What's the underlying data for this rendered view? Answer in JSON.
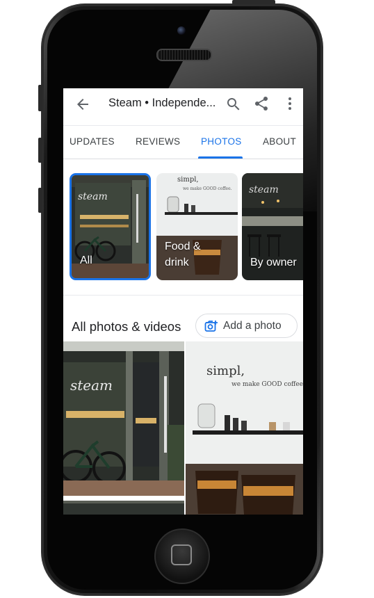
{
  "app": {
    "title": "Steam • Independe...",
    "icons": [
      "back-arrow-icon",
      "search-icon",
      "share-icon",
      "more-vert-icon"
    ]
  },
  "tabs": [
    {
      "label": "UPDATES",
      "active": false
    },
    {
      "label": "REVIEWS",
      "active": false
    },
    {
      "label": "PHOTOS",
      "active": true
    },
    {
      "label": "ABOUT",
      "active": false
    }
  ],
  "categories": [
    {
      "label": "All",
      "selected": true
    },
    {
      "label_line1": "Food &",
      "label_line2": "drink",
      "selected": false
    },
    {
      "label": "By owner",
      "selected": false
    }
  ],
  "photos_section": {
    "title": "All photos & videos",
    "add_button_label": "Add a photo",
    "add_button_icon": "add-photo-camera-icon"
  },
  "wall_text": {
    "line1": "simpl,",
    "line2": "we make GOOD coffee."
  },
  "colors": {
    "accent": "#1a73e8",
    "text_primary": "#202124",
    "text_secondary": "#3c4043",
    "divider": "#dadce0"
  }
}
